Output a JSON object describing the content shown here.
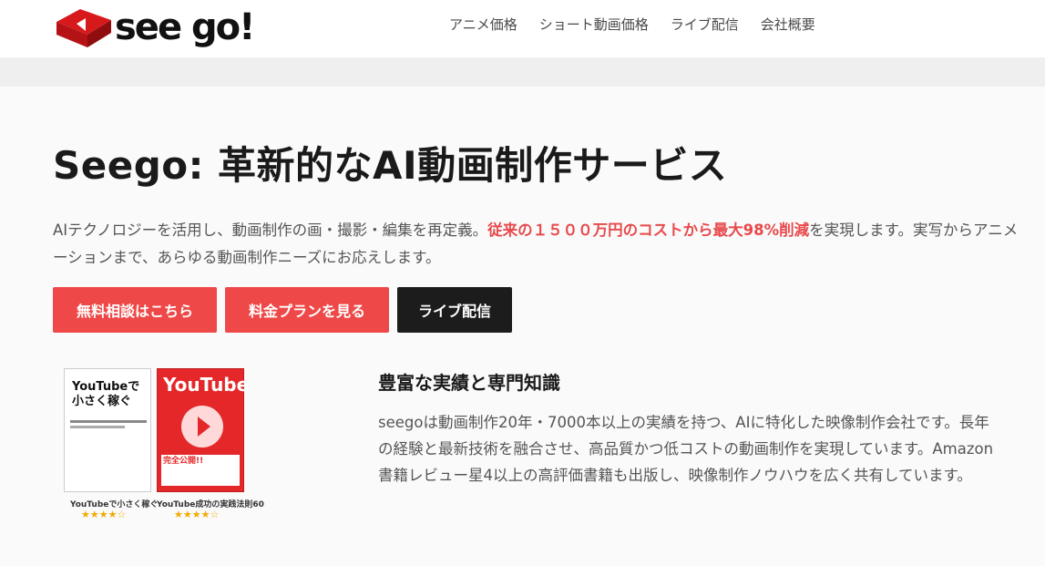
{
  "header": {
    "logo_text": "see go!",
    "nav": [
      {
        "label": "アニメ価格"
      },
      {
        "label": "ショート動画価格"
      },
      {
        "label": "ライブ配信"
      },
      {
        "label": "会社概要"
      }
    ]
  },
  "hero": {
    "title": "Seego: 革新的なAI動画制作サービス",
    "desc_prefix": "AIテクノロジーを活用し、動画制作の画・撮影・編集を再定義。",
    "desc_highlight": "従来の１５００万円のコストから最大98%削減",
    "desc_suffix": "を実現します。実写からアニメーションまで、あらゆる動画制作ニーズにお応えします。",
    "buttons": [
      {
        "label": "無料相談はこちら"
      },
      {
        "label": "料金プランを見る"
      },
      {
        "label": "ライブ配信"
      }
    ]
  },
  "books": [
    {
      "cover_title": "YouTubeで小さく稼ぐ",
      "label": "YouTubeで小さく稼ぐ",
      "stars": "★★★★☆",
      "rating": 4
    },
    {
      "cover_title": "YouTube",
      "cover_band": "完全公開!!",
      "label": "YouTube成功の実践法則60",
      "stars": "★★★★☆",
      "rating": 4
    }
  ],
  "experience": {
    "title": "豊富な実績と専門知識",
    "desc": "seegoは動画制作20年・7000本以上の実績を持つ、AIに特化した映像制作会社です。長年の経験と最新技術を融合させ、高品質かつ低コストの動画制作を実現しています。Amazon書籍レビュー星4以上の高評価書籍も出版し、映像制作ノウハウを広く共有しています。"
  },
  "colors": {
    "accent": "#ef4848",
    "dark_button": "#1c1c1c",
    "highlight_text": "#e8494b",
    "star": "#f2a900"
  }
}
